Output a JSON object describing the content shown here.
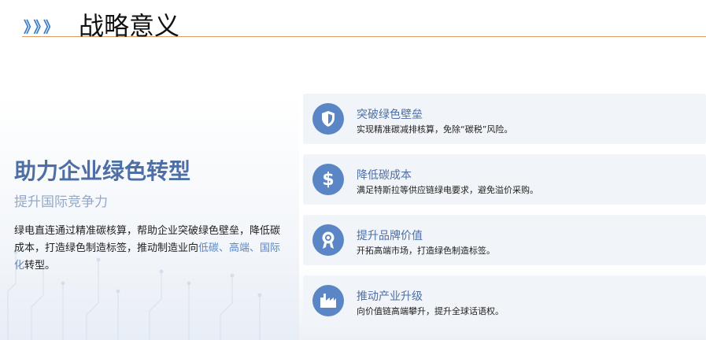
{
  "header": {
    "chevrons": "》》》",
    "title": "战略意义"
  },
  "left": {
    "heading": "助力企业绿色转型",
    "subheading": "提升国际竞争力",
    "body_part1": "绿电直连通过精准碳核算，帮助企业突破绿色壁垒，降低碳成本，打造绿色制造标签，推动制造业向",
    "body_highlight": "低碳、高端、国际化",
    "body_part2": "转型。"
  },
  "cards": [
    {
      "icon": "shield-icon",
      "title": "突破绿色壁垒",
      "desc": "实现精准碳减排核算，免除“碳税”风险。"
    },
    {
      "icon": "dollar-icon",
      "title": "降低碳成本",
      "desc": "满足特斯拉等供应链绿电要求，避免溢价采购。"
    },
    {
      "icon": "award-badge-icon",
      "title": "提升品牌价值",
      "desc": "开拓高端市场，打造绿色制造标签。"
    },
    {
      "icon": "factory-icon",
      "title": "推动产业升级",
      "desc": "向价值链高端攀升，提升全球话语权。"
    }
  ],
  "colors": {
    "accent_blue": "#5b86c6",
    "heading_blue": "#4d6fa6",
    "header_rule": "#e29a63"
  }
}
